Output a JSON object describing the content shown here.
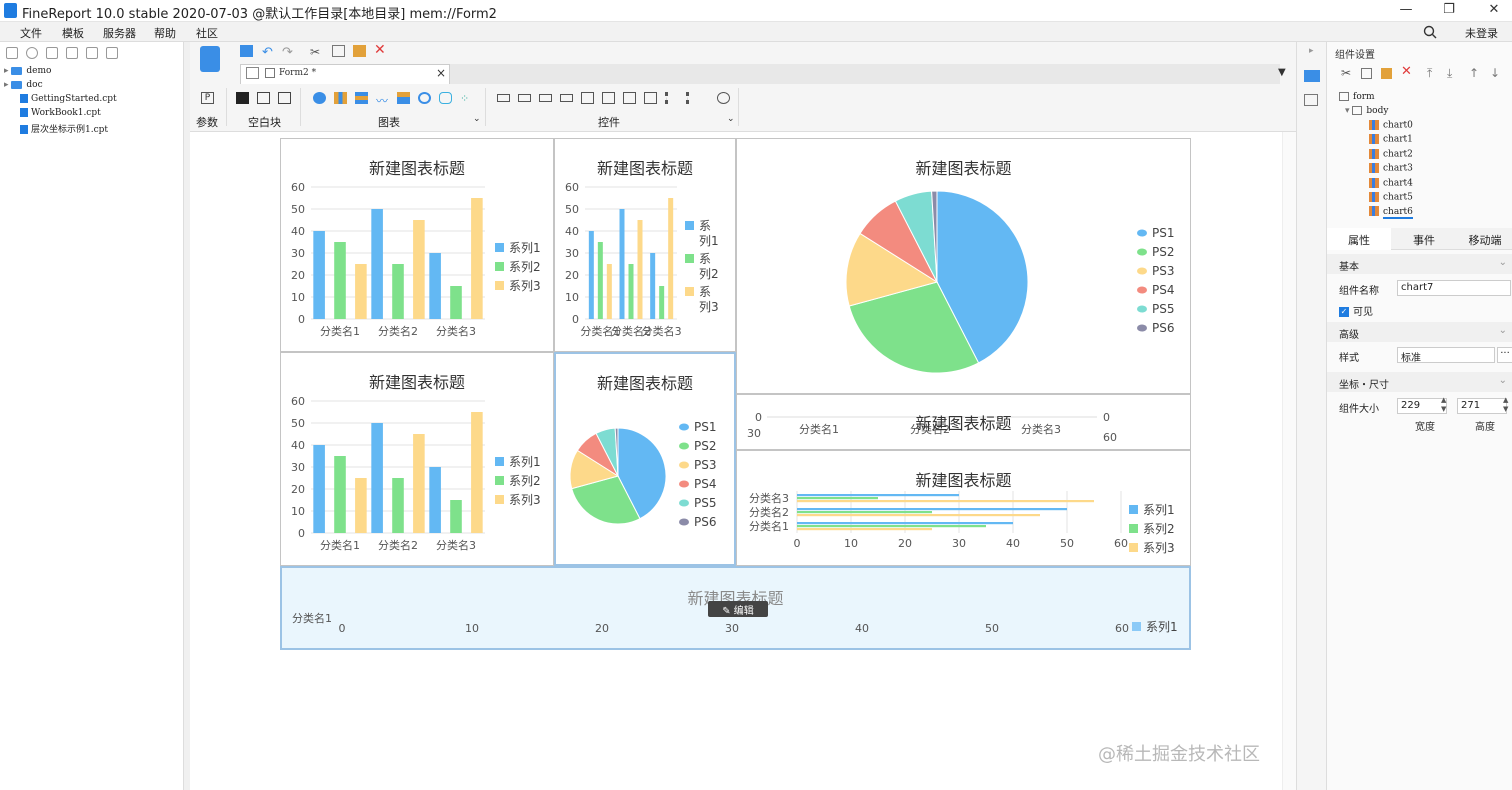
{
  "window": {
    "title": "FineReport 10.0 stable 2020-07-03 @默认工作目录[本地目录]    mem://Form2",
    "minimize": "—",
    "maximize": "❐",
    "close": "✕"
  },
  "menu": {
    "items": [
      "文件",
      "模板",
      "服务器",
      "帮助",
      "社区"
    ],
    "login": "未登录"
  },
  "tree": {
    "items": [
      {
        "label": "demo",
        "type": "folder"
      },
      {
        "label": "doc",
        "type": "folder"
      },
      {
        "label": "GettingStarted.cpt",
        "type": "file"
      },
      {
        "label": "WorkBook1.cpt",
        "type": "file"
      },
      {
        "label": "层次坐标示例1.cpt",
        "type": "file"
      }
    ]
  },
  "tab": {
    "label": "Form2 *",
    "close": "×"
  },
  "ribbon": {
    "groups": {
      "param": "参数",
      "blank": "空白块",
      "chart": "图表",
      "widget": "控件"
    }
  },
  "charts": {
    "common_title": "新建图表标题",
    "edit_label": "编辑",
    "categories": [
      "分类名1",
      "分类名2",
      "分类名3"
    ],
    "series_names": [
      "系列1",
      "系列2",
      "系列3"
    ],
    "series_names_wrap": [
      [
        "系",
        "列1"
      ],
      [
        "系",
        "列2"
      ],
      [
        "系",
        "列3"
      ]
    ],
    "bar_values": [
      [
        40,
        50,
        30
      ],
      [
        35,
        25,
        15
      ],
      [
        25,
        45,
        55
      ]
    ],
    "bar_ticks": [
      "0",
      "10",
      "20",
      "30",
      "40",
      "50",
      "60"
    ],
    "pie_values": [
      45,
      30,
      14,
      9,
      7,
      1
    ],
    "pie_names": [
      "PS1",
      "PS2",
      "PS3",
      "PS4",
      "PS5",
      "PS6"
    ],
    "mini_axis": {
      "left0": "0",
      "left30": "30",
      "right0": "0",
      "right60": "60"
    },
    "hbar_ticks": [
      "0",
      "10",
      "20",
      "30",
      "40",
      "50",
      "60"
    ]
  },
  "colors": {
    "s1": "#63b8f3",
    "s2": "#7ee18b",
    "s3": "#fdd98a",
    "ps4": "#f38b7f",
    "ps5": "#7ddcd2",
    "ps6": "#8b8ba8",
    "accent": "#1f7ce0"
  },
  "chart_data": [
    {
      "type": "bar",
      "title": "新建图表标题",
      "categories": [
        "分类名1",
        "分类名2",
        "分类名3"
      ],
      "series": [
        {
          "name": "系列1",
          "values": [
            40,
            50,
            30
          ]
        },
        {
          "name": "系列2",
          "values": [
            35,
            25,
            15
          ]
        },
        {
          "name": "系列3",
          "values": [
            25,
            45,
            55
          ]
        }
      ],
      "ylim": [
        0,
        60
      ]
    },
    {
      "type": "pie",
      "title": "新建图表标题",
      "categories": [
        "PS1",
        "PS2",
        "PS3",
        "PS4",
        "PS5",
        "PS6"
      ],
      "values": [
        45,
        30,
        14,
        9,
        7,
        1
      ]
    }
  ],
  "right": {
    "header": "组件设置",
    "tree": {
      "form": "form",
      "body": "body",
      "charts": [
        "chart0",
        "chart1",
        "chart2",
        "chart3",
        "chart4",
        "chart5",
        "chart6"
      ]
    },
    "tabs": [
      "属性",
      "事件",
      "移动端"
    ],
    "sections": {
      "basic": "基本",
      "advanced": "高级",
      "coord": "坐标・尺寸"
    },
    "fields": {
      "name_label": "组件名称",
      "name_value": "chart7",
      "visible_label": "可见",
      "style_label": "样式",
      "style_value": "标准",
      "more": "···",
      "size_label": "组件大小",
      "width": "229",
      "height": "271",
      "width_label": "宽度",
      "height_label": "高度"
    }
  },
  "watermark": "@稀土掘金技术社区"
}
